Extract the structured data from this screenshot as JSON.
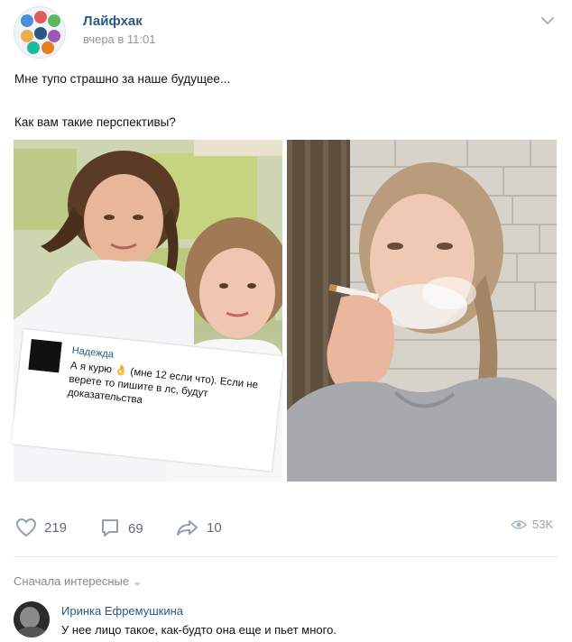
{
  "post": {
    "group_name": "Лайфхак",
    "time": "вчера в 11:01",
    "text_line_1": "Мне тупо страшно за наше будущее...",
    "text_line_2": "Как вам такие перспективы?"
  },
  "embedded_screenshot": {
    "author": "Надежда",
    "text": "А я курю 👌 (мне 12 если что). Если не верете то пишите в лс, будут доказательства"
  },
  "actions": {
    "likes": "219",
    "comments": "69",
    "shares": "10",
    "views": "53K"
  },
  "comments_section": {
    "sort_label": "Сначала интересные",
    "comment": {
      "author": "Иринка Ефремушкина",
      "text": "У нее лицо такое, как-будто она еще и пьет много."
    }
  },
  "icons": {
    "like": "heart-icon",
    "comment": "comment-icon",
    "share": "share-arrow-icon",
    "views": "eye-icon",
    "more": "chevron-down-icon"
  },
  "colors": {
    "link": "#2a5885",
    "muted": "#939393"
  }
}
